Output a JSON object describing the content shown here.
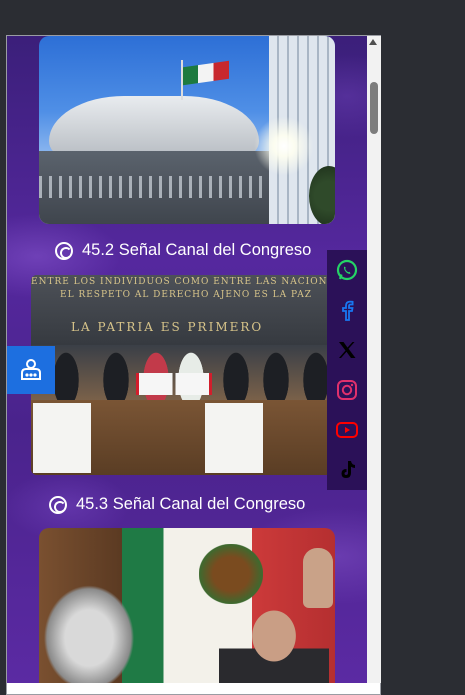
{
  "feed": {
    "captions": [
      "45.2 Señal Canal del Congreso",
      "45.3 Señal Canal del Congreso"
    ],
    "photo2_inscriptions": {
      "line1": "ENTRE LOS INDIVIDUOS COMO ENTRE LAS NACIONES",
      "line2": "EL RESPETO AL DERECHO AJENO ES LA PAZ",
      "line3": "LA PATRIA ES PRIMERO"
    },
    "caption_icon": "cc-channel-icon"
  },
  "share_bar": {
    "items": [
      {
        "name": "whatsapp",
        "icon": "whatsapp-icon",
        "color": "#25d366"
      },
      {
        "name": "facebook",
        "icon": "facebook-icon",
        "color": "#1877f2"
      },
      {
        "name": "x",
        "icon": "x-icon",
        "color": "#000000"
      },
      {
        "name": "instagram",
        "icon": "instagram-icon",
        "color": "#e1306c"
      },
      {
        "name": "youtube",
        "icon": "youtube-icon",
        "color": "#ff0000"
      },
      {
        "name": "tiktok",
        "icon": "tiktok-icon",
        "color": "#000000"
      }
    ],
    "background": "#2b1158"
  },
  "accessibility": {
    "icon": "accessibility-icon",
    "color": "#1d6fe0"
  },
  "colors": {
    "page_bg_top": "#3b1f7a",
    "page_bg_mid": "#55289e",
    "caption_text": "#ffffff"
  }
}
